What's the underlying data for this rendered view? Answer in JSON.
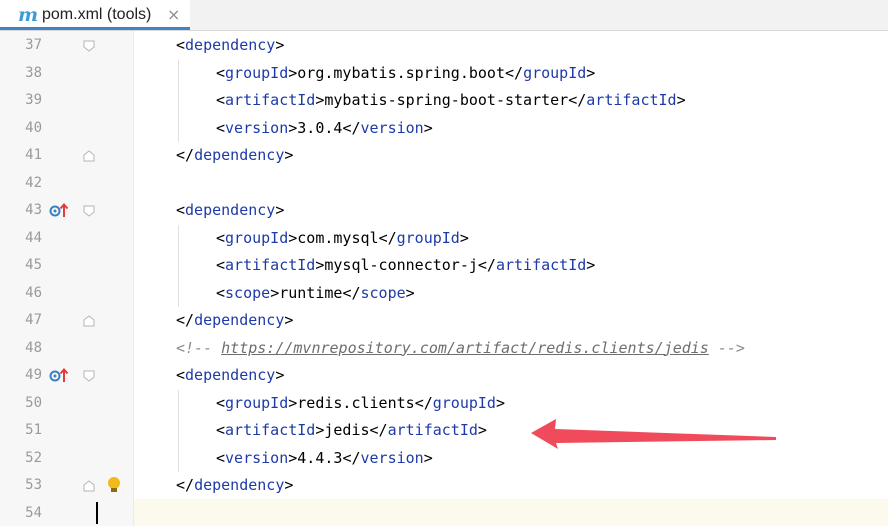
{
  "tab": {
    "title": "pom.xml (tools)",
    "icon": "m",
    "close": "×"
  },
  "lines": [
    {
      "n": "37",
      "indent": 1,
      "kind": "open",
      "tag": "dependency"
    },
    {
      "n": "38",
      "indent": 2,
      "kind": "elem",
      "tag": "groupId",
      "value": "org.mybatis.spring.boot"
    },
    {
      "n": "39",
      "indent": 2,
      "kind": "elem",
      "tag": "artifactId",
      "value": "mybatis-spring-boot-starter"
    },
    {
      "n": "40",
      "indent": 2,
      "kind": "elem",
      "tag": "version",
      "value": "3.0.4"
    },
    {
      "n": "41",
      "indent": 1,
      "kind": "close",
      "tag": "dependency"
    },
    {
      "n": "42",
      "indent": 0,
      "kind": "blank"
    },
    {
      "n": "43",
      "indent": 1,
      "kind": "open",
      "tag": "dependency",
      "marker": true
    },
    {
      "n": "44",
      "indent": 2,
      "kind": "elem",
      "tag": "groupId",
      "value": "com.mysql"
    },
    {
      "n": "45",
      "indent": 2,
      "kind": "elem",
      "tag": "artifactId",
      "value": "mysql-connector-j"
    },
    {
      "n": "46",
      "indent": 2,
      "kind": "elem",
      "tag": "scope",
      "value": "runtime"
    },
    {
      "n": "47",
      "indent": 1,
      "kind": "close",
      "tag": "dependency"
    },
    {
      "n": "48",
      "indent": 1,
      "kind": "comment",
      "prefix": "<!-- ",
      "url": "https://mvnrepository.com/artifact/redis.clients/jedis",
      "suffix": " -->"
    },
    {
      "n": "49",
      "indent": 1,
      "kind": "open",
      "tag": "dependency",
      "marker": true
    },
    {
      "n": "50",
      "indent": 2,
      "kind": "elem",
      "tag": "groupId",
      "value": "redis.clients"
    },
    {
      "n": "51",
      "indent": 2,
      "kind": "elem",
      "tag": "artifactId",
      "value": "jedis"
    },
    {
      "n": "52",
      "indent": 2,
      "kind": "elem",
      "tag": "version",
      "value": "4.4.3"
    },
    {
      "n": "53",
      "indent": 1,
      "kind": "close",
      "tag": "dependency",
      "bulb": true
    },
    {
      "n": "54",
      "indent": 0,
      "kind": "blank",
      "current": true
    }
  ],
  "colors": {
    "tag": "#1e3aa8",
    "arrow": "#f04b5a",
    "bulb": "#f2b91a",
    "marker": "#3a7fc2",
    "marker_arrow": "#e03c3c"
  },
  "annotation": {
    "type": "arrow",
    "points_to_line": "51"
  }
}
